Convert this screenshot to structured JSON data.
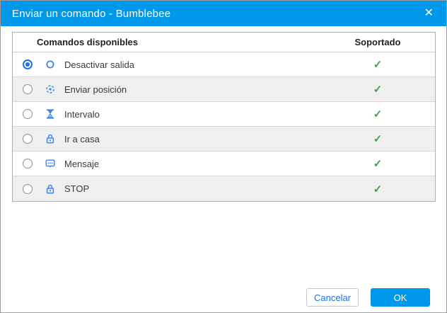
{
  "window": {
    "title": "Enviar un comando - Bumblebee",
    "close_glyph": "✕"
  },
  "table": {
    "headers": {
      "commands": "Comandos disponibles",
      "supported": "Soportado"
    },
    "check_glyph": "✓",
    "rows": [
      {
        "label": "Desactivar salida",
        "icon": "circle-icon",
        "selected": true,
        "supported": true
      },
      {
        "label": "Enviar posición",
        "icon": "crosshair-icon",
        "selected": false,
        "supported": true
      },
      {
        "label": "Intervalo",
        "icon": "hourglass-icon",
        "selected": false,
        "supported": true
      },
      {
        "label": "Ir a casa",
        "icon": "lock-icon",
        "selected": false,
        "supported": true
      },
      {
        "label": "Mensaje",
        "icon": "message-icon",
        "selected": false,
        "supported": true
      },
      {
        "label": "STOP",
        "icon": "lock-icon",
        "selected": false,
        "supported": true
      }
    ]
  },
  "buttons": {
    "cancel": "Cancelar",
    "ok": "OK"
  },
  "colors": {
    "accent": "#0098eb",
    "icon_blue": "#3b82f0",
    "check_green": "#45a049",
    "row_alt": "#efefef",
    "radio_selected": "#1a73e8"
  }
}
